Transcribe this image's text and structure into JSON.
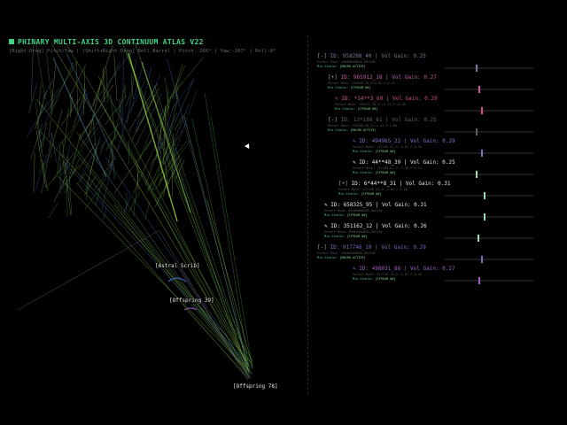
{
  "hud": {
    "title": "PHINARY MULTI-AXIS 3D CONTINUUM ATLAS V22",
    "hint": "[Right-Drag] Pitch/Yaw | [Shift+Right-Drag] Roll Barrel | Pitch:-266° | Yaw:-207° | Roll:0°"
  },
  "canvas_labels": {
    "astral": "[Astral Scrib]",
    "offspring39": "[Offspring 39]",
    "offspring78": "[Offspring 78]"
  },
  "entries": [
    {
      "toggle": "[-]",
      "id_text": "ID: 958288_40 | Vol Gain: 0.25",
      "meta": "Parent Mash: 00000000000_ORIGIN",
      "mix_label": "Mix Status:",
      "mix_value": "[MACRO ACTIVE]",
      "color": "#7a7a9a",
      "gain": 0.25
    },
    {
      "toggle": "[+]",
      "id_text": "ID: 965912_18 | Vol Gain: 0.27",
      "meta": "Parent Mash: 958288_40_D:0.03_F:0.49",
      "mix_label": "Mix Status:",
      "mix_value": "[STREAM ON]",
      "color": "#c060a8",
      "gain": 0.27
    },
    {
      "toggle": "✎",
      "id_text": "ID: *14**3_69 | Vol Gain: 0.29",
      "meta": "Parent Mash: 965912_18_D:+0.17_F:+0.08",
      "mix_label": "Mix Status:",
      "mix_value": "[STREAM ON]",
      "color": "#d05090",
      "gain": 0.29
    },
    {
      "toggle": "[-]",
      "id_text": "ID: 13*188_61 | Vol Gain: 0.25",
      "meta": "Parent Mash: 958288_40_D:+1.44_D:1.86",
      "mix_label": "Mix Status:",
      "mix_value": "[MACRO ACTIVE]",
      "color": "#606060",
      "gain": 0.25
    },
    {
      "toggle": "✎",
      "id_text": "ID: 494965_22 | Vol Gain: 0.29",
      "meta": "Parent Mash: 13*188_61_D:-2.07_F:0.35",
      "mix_label": "Mix Status:",
      "mix_value": "[STREAM ON]",
      "color": "#8a70c8",
      "gain": 0.29
    },
    {
      "toggle": "✎",
      "id_text": "ID: 44**48_39 | Vol Gain: 0.25",
      "meta": "Parent Mash: 13*188_61_D:-2.98_F:0.23",
      "mix_label": "Mix Status:",
      "mix_value": "[STREAM ON]",
      "color": "#e8e8e8",
      "gain": 0.25
    },
    {
      "toggle": "[+]",
      "id_text": "ID: 6*44**8_31 | Vol Gain: 0.31",
      "meta": "Parent Mash: 13*188_61_D:-4.02_F:0.06",
      "mix_label": "Mix Status:",
      "mix_value": "[STREAM ON]",
      "color": "#e8e8e8",
      "gain": 0.31
    },
    {
      "toggle": "✎",
      "id_text": "ID: 658325_95 | Vol Gain: 0.31",
      "meta": "Parent Mash: 00000000000_ORIGIN",
      "mix_label": "Mix Status:",
      "mix_value": "[STREAM ON]",
      "color": "#e8e8e8",
      "gain": 0.31
    },
    {
      "toggle": "✎",
      "id_text": "ID: 351162_12 | Vol Gain: 0.26",
      "meta": "Parent Mash: 00000000000_ORIGIN",
      "mix_label": "Mix Status:",
      "mix_value": "[STREAM ON]",
      "color": "#e8e8e8",
      "gain": 0.26
    },
    {
      "toggle": "[-]",
      "id_text": "ID: 917746_19 | Vol Gain: 0.29",
      "meta": "Parent Mash: 00000000000_ORIGIN",
      "mix_label": "Mix Status:",
      "mix_value": "[MACRO ACTIVE]",
      "color": "#7070c0",
      "gain": 0.29
    },
    {
      "toggle": "✎",
      "id_text": "ID: 498031_86 | Vol Gain: 0.27",
      "meta": "Parent Mash: 917746_19_D:-1.07_F:0.46",
      "mix_label": "Mix Status:",
      "mix_value": "[STREAM ON]",
      "color": "#a060c0",
      "gain": 0.27
    }
  ],
  "colors": {
    "accent": "#3fd48a",
    "mix_label": "#4fc37a",
    "trail_green": "#7fbf3f",
    "trail_blue": "#3f6fbf"
  }
}
